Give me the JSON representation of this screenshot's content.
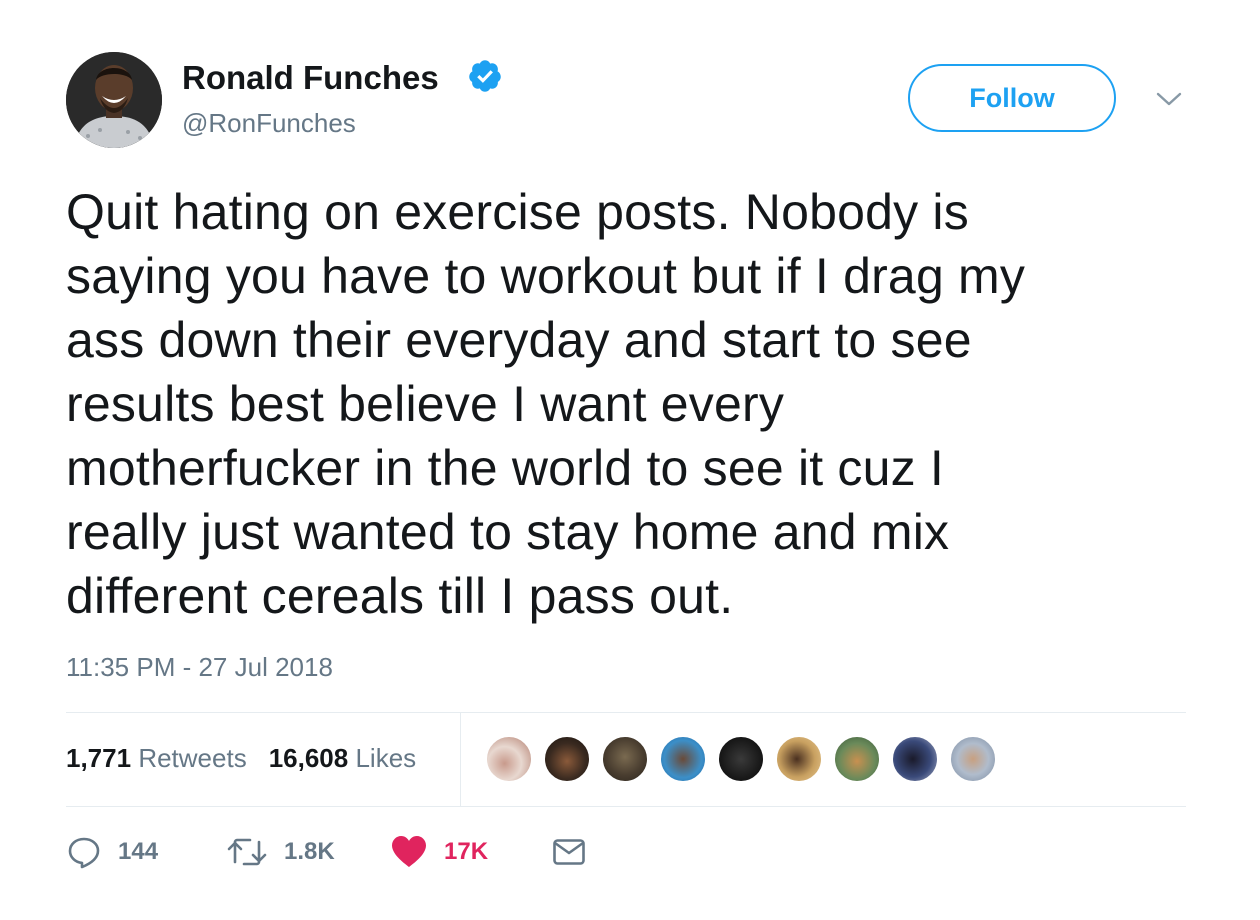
{
  "user": {
    "display_name": "Ronald Funches",
    "handle": "@RonFunches",
    "verified": true
  },
  "header": {
    "follow_label": "Follow"
  },
  "tweet": {
    "lines": [
      "Quit hating on exercise posts. Nobody is",
      "saying you have to workout but if I drag my",
      "ass down their everyday and start to see",
      "results best believe I want every",
      "motherfucker in the world to see it cuz I",
      "really just wanted to stay home and mix",
      "different cereals till I pass out."
    ],
    "timestamp": "11:35 PM - 27 Jul 2018"
  },
  "stats": {
    "retweets_count": "1,771",
    "retweets_label": "Retweets",
    "likes_count": "16,608",
    "likes_label": "Likes"
  },
  "actions": {
    "replies": "144",
    "retweets": "1.8K",
    "likes": "17K"
  },
  "colors": {
    "accent": "#1da1f2",
    "like": "#e0245e",
    "secondary_text": "#657786",
    "border": "#e6ecf0"
  },
  "icons": {
    "verified": "verified-badge-icon",
    "more": "chevron-down-icon",
    "reply": "reply-icon",
    "retweet": "retweet-icon",
    "like": "heart-icon",
    "dm": "envelope-icon"
  }
}
